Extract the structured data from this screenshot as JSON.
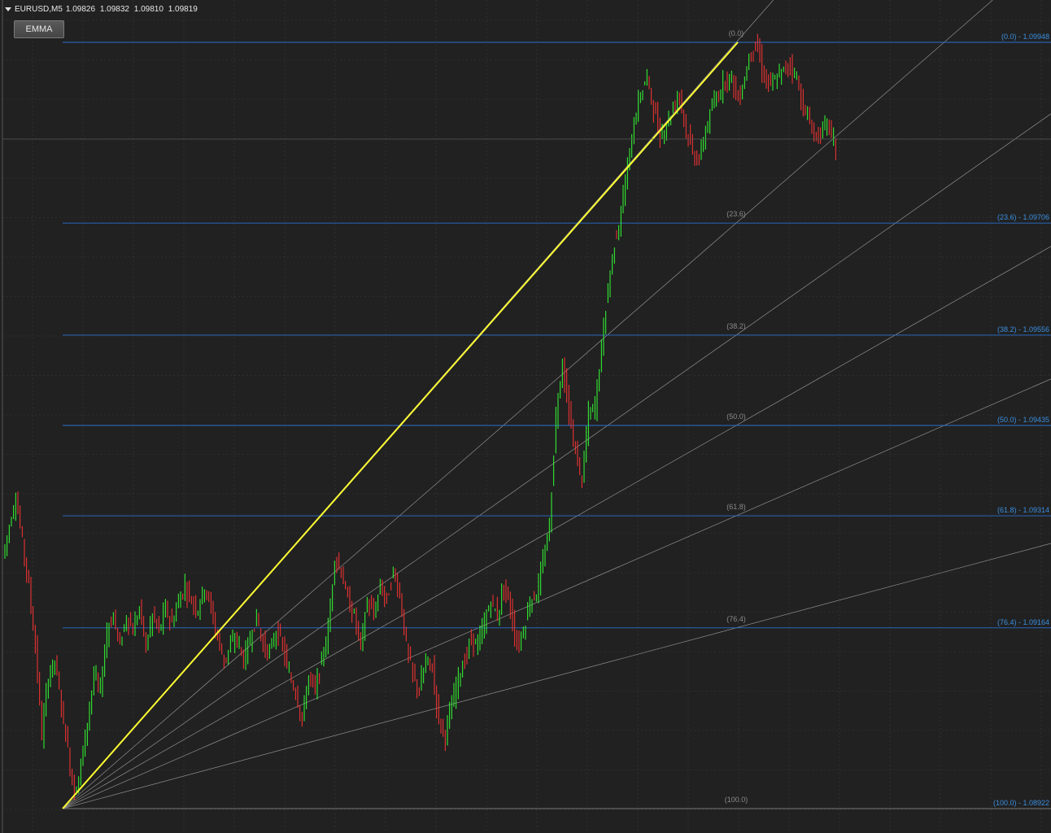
{
  "header": {
    "symbol": "EURUSD,M5",
    "open": "1.09826",
    "high": "1.09832",
    "low": "1.09810",
    "close": "1.09819"
  },
  "toolbar": {
    "emma_label": "EMMA"
  },
  "colors": {
    "background": "#212121",
    "grid": "#3a3a3a",
    "fib_line": "#2a6fd0",
    "fib_label": "#3a8fe0",
    "fan_line": "#8f8f8f",
    "trend_line": "#ffff33",
    "bull_candle": "#33ff33",
    "bear_candle": "#ff3333"
  },
  "chart_data": {
    "type": "line",
    "instrument": "EURUSD",
    "timeframe": "M5",
    "price_anchor_high": 1.09948,
    "price_anchor_low": 1.08922,
    "fib_levels": [
      {
        "level": "0.0",
        "left": "(0.0)",
        "right": "(0.0) - 1.09948",
        "price": 1.09948
      },
      {
        "level": "23.6",
        "left": "(23.6)",
        "right": "(23.6) - 1.09706",
        "price": 1.09706
      },
      {
        "level": "38.2",
        "left": "(38.2)",
        "right": "(38.2) - 1.09556",
        "price": 1.09556
      },
      {
        "level": "50.0",
        "left": "(50.0)",
        "right": "(50.0) - 1.09435",
        "price": 1.09435
      },
      {
        "level": "61.8",
        "left": "(61.8)",
        "right": "(61.8) - 1.09314",
        "price": 1.09314
      },
      {
        "level": "76.4",
        "left": "(76.4)",
        "right": "(76.4) - 1.09164",
        "price": 1.09164
      },
      {
        "level": "100.0",
        "left": "(100.0)",
        "right": "(100.0) - 1.08922",
        "price": 1.08922
      }
    ],
    "price_path": [
      [
        0,
        1.0926
      ],
      [
        3,
        1.093
      ],
      [
        6,
        1.0934
      ],
      [
        9,
        1.0928
      ],
      [
        12,
        1.0922
      ],
      [
        15,
        1.0914
      ],
      [
        18,
        1.0902
      ],
      [
        21,
        1.091
      ],
      [
        24,
        1.0912
      ],
      [
        27,
        1.0906
      ],
      [
        30,
        1.09
      ],
      [
        33,
        1.0894
      ],
      [
        36,
        1.0898
      ],
      [
        39,
        1.0904
      ],
      [
        42,
        1.091
      ],
      [
        45,
        1.0908
      ],
      [
        48,
        1.0916
      ],
      [
        51,
        1.0918
      ],
      [
        54,
        1.0914
      ],
      [
        57,
        1.0918
      ],
      [
        60,
        1.0916
      ],
      [
        63,
        1.0919
      ],
      [
        66,
        1.0914
      ],
      [
        69,
        1.0918
      ],
      [
        72,
        1.0916
      ],
      [
        75,
        1.0919
      ],
      [
        78,
        1.0917
      ],
      [
        81,
        1.092
      ],
      [
        84,
        1.0922
      ],
      [
        87,
        1.092
      ],
      [
        90,
        1.0919
      ],
      [
        93,
        1.0922
      ],
      [
        96,
        1.0919
      ],
      [
        99,
        1.0915
      ],
      [
        102,
        1.0912
      ],
      [
        105,
        1.0914
      ],
      [
        108,
        1.0915
      ],
      [
        111,
        1.0912
      ],
      [
        114,
        1.0915
      ],
      [
        117,
        1.0918
      ],
      [
        120,
        1.0914
      ],
      [
        123,
        1.0913
      ],
      [
        126,
        1.0916
      ],
      [
        129,
        1.0914
      ],
      [
        132,
        1.091
      ],
      [
        135,
        1.0908
      ],
      [
        138,
        1.0904
      ],
      [
        141,
        1.091
      ],
      [
        144,
        1.0908
      ],
      [
        147,
        1.0912
      ],
      [
        150,
        1.0916
      ],
      [
        153,
        1.0926
      ],
      [
        156,
        1.0924
      ],
      [
        159,
        1.092
      ],
      [
        162,
        1.0918
      ],
      [
        165,
        1.0914
      ],
      [
        168,
        1.092
      ],
      [
        171,
        1.0918
      ],
      [
        174,
        1.0922
      ],
      [
        177,
        1.092
      ],
      [
        180,
        1.0924
      ],
      [
        183,
        1.0921
      ],
      [
        186,
        1.0914
      ],
      [
        189,
        1.091
      ],
      [
        192,
        1.0908
      ],
      [
        195,
        1.0912
      ],
      [
        198,
        1.0911
      ],
      [
        201,
        1.0904
      ],
      [
        204,
        1.0902
      ],
      [
        207,
        1.0906
      ],
      [
        210,
        1.091
      ],
      [
        213,
        1.0912
      ],
      [
        216,
        1.0915
      ],
      [
        219,
        1.0914
      ],
      [
        222,
        1.0917
      ],
      [
        225,
        1.092
      ],
      [
        228,
        1.0918
      ],
      [
        231,
        1.0922
      ],
      [
        234,
        1.0919
      ],
      [
        237,
        1.0914
      ],
      [
        240,
        1.0916
      ],
      [
        243,
        1.092
      ],
      [
        246,
        1.0921
      ],
      [
        249,
        1.0925
      ],
      [
        252,
        1.093
      ],
      [
        255,
        1.0945
      ],
      [
        258,
        1.0952
      ],
      [
        261,
        1.0945
      ],
      [
        264,
        1.094
      ],
      [
        267,
        1.0936
      ],
      [
        270,
        1.0945
      ],
      [
        273,
        1.0946
      ],
      [
        276,
        1.0954
      ],
      [
        279,
        1.0962
      ],
      [
        282,
        1.0968
      ],
      [
        285,
        1.0972
      ],
      [
        288,
        1.0978
      ],
      [
        291,
        1.0984
      ],
      [
        294,
        1.0988
      ],
      [
        297,
        1.099
      ],
      [
        300,
        1.0986
      ],
      [
        303,
        1.0982
      ],
      [
        306,
        1.0984
      ],
      [
        309,
        1.0986
      ],
      [
        312,
        1.0988
      ],
      [
        315,
        1.0983
      ],
      [
        318,
        1.098
      ],
      [
        321,
        1.0979
      ],
      [
        324,
        1.0983
      ],
      [
        327,
        1.0986
      ],
      [
        330,
        1.0988
      ],
      [
        333,
        1.099
      ],
      [
        336,
        1.099
      ],
      [
        339,
        1.0987
      ],
      [
        342,
        1.099
      ],
      [
        345,
        1.0994
      ],
      [
        348,
        1.0994
      ],
      [
        351,
        1.099
      ],
      [
        354,
        1.0989
      ],
      [
        357,
        1.099
      ],
      [
        360,
        1.0991
      ],
      [
        363,
        1.0992
      ],
      [
        366,
        1.099
      ],
      [
        369,
        1.0986
      ],
      [
        372,
        1.0984
      ],
      [
        375,
        1.0982
      ],
      [
        378,
        1.0983
      ],
      [
        381,
        1.0984
      ],
      [
        384,
        1.098
      ]
    ],
    "ylim": [
      1.0889,
      1.1
    ],
    "grid": true
  }
}
